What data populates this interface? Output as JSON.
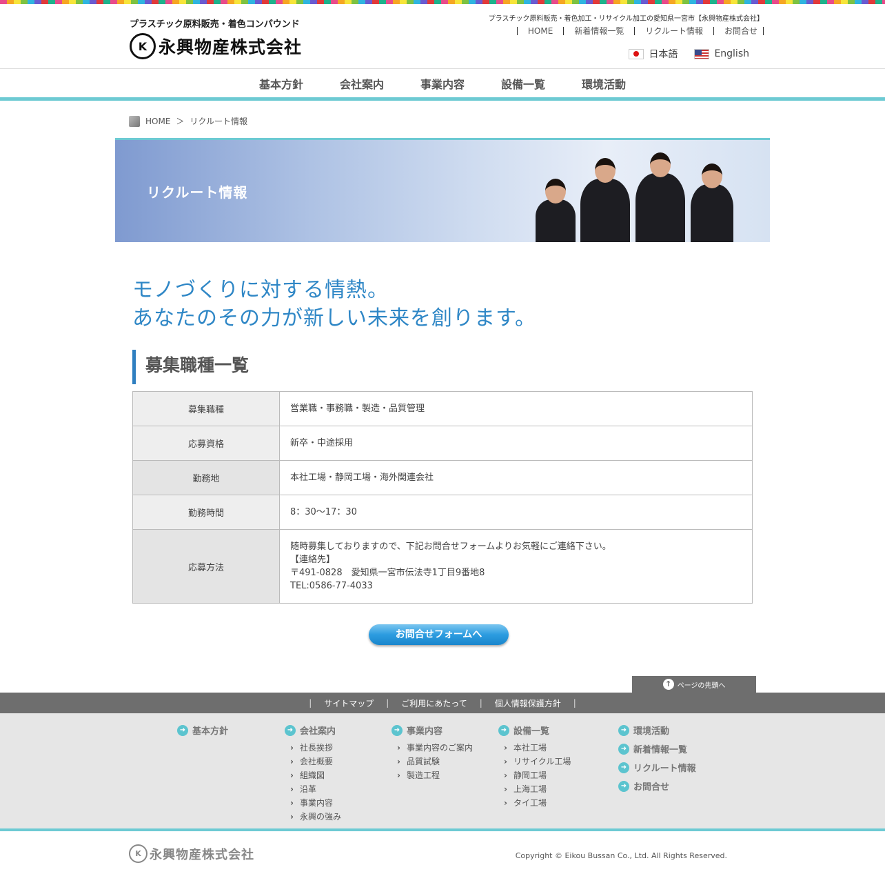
{
  "header": {
    "tagline": "プラスチック原料販売・着色コンパウンド",
    "logo_mark": "K",
    "company_name": "永興物産株式会社",
    "top_caption": "プラスチック原料販売・着色加工・リサイクル加工の愛知県一宮市【永興物産株式会社】",
    "util_nav": [
      "HOME",
      "新着情報一覧",
      "リクルート情報",
      "お問合せ"
    ],
    "lang_ja": "日本語",
    "lang_en": "English"
  },
  "global_nav": [
    "基本方針",
    "会社案内",
    "事業内容",
    "設備一覧",
    "環境活動"
  ],
  "breadcrumb": {
    "home": "HOME",
    "sep": "＞",
    "current": "リクルート情報"
  },
  "hero": {
    "title": "リクルート情報"
  },
  "catch": {
    "line1": "モノづくりに対する情熱。",
    "line2": "あなたのその力が新しい未来を創ります。"
  },
  "section_title": "募集職種一覧",
  "jobs": [
    {
      "label": "募集職種",
      "value": "営業職・事務職・製造・品質管理"
    },
    {
      "label": "応募資格",
      "value": "新卒・中途採用"
    },
    {
      "label": "勤務地",
      "value": "本社工場・静岡工場・海外関連会社"
    },
    {
      "label": "勤務時間",
      "value": "8：30〜17：30"
    }
  ],
  "apply": {
    "label": "応募方法",
    "line1": "随時募集しておりますので、下記お問合せフォームよりお気軽にご連絡下さい。",
    "line2": "【連絡先】",
    "line3": "〒491-0828　愛知県一宮市伝法寺1丁目9番地8",
    "line4": "TEL:0586-77-4033"
  },
  "contact_button": "お問合せフォームへ",
  "pagetop": "ページの先頭へ",
  "footer_bar": [
    "サイトマップ",
    "ご利用にあたって",
    "個人情報保護方針"
  ],
  "footer_cols": {
    "c1": {
      "head": "基本方針",
      "items": []
    },
    "c2": {
      "head": "会社案内",
      "items": [
        "社長挨拶",
        "会社概要",
        "組織図",
        "沿革",
        "事業内容",
        "永興の強み"
      ]
    },
    "c3": {
      "head": "事業内容",
      "items": [
        "事業内容のご案内",
        "品質試験",
        "製造工程"
      ]
    },
    "c4": {
      "head": "設備一覧",
      "items": [
        "本社工場",
        "リサイクル工場",
        "静岡工場",
        "上海工場",
        "タイ工場"
      ]
    },
    "c5": [
      "環境活動",
      "新着情報一覧",
      "リクルート情報",
      "お問合せ"
    ]
  },
  "footer_logo": "永興物産株式会社",
  "copyright": "Copyright © Eikou Bussan Co., Ltd. All Rights Reserved.",
  "colors": {
    "accent_teal": "#6dcad3",
    "catch_blue": "#2f87c6",
    "button_blue": "#2c9ce0"
  }
}
